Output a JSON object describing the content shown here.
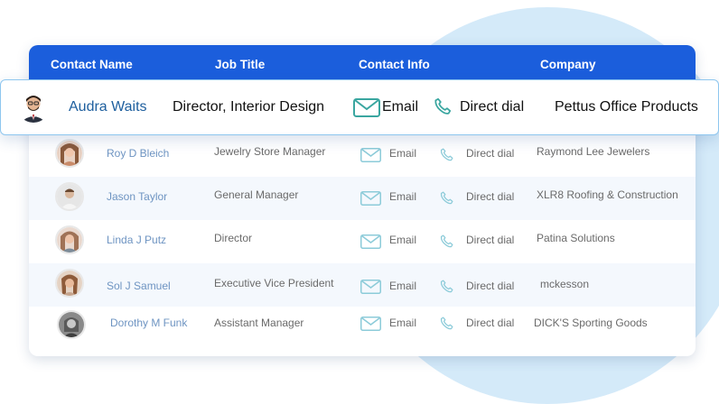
{
  "header": {
    "contact_name": "Contact Name",
    "job_title": "Job Title",
    "contact_info": "Contact Info",
    "company": "Company"
  },
  "featured": {
    "name": "Audra Waits",
    "title": "Director, Interior Design",
    "email": "Email",
    "phone": "Direct dial",
    "company": "Pettus Office Products"
  },
  "rows": [
    {
      "name": "Roy D Bleich",
      "title": "Jewelry Store Manager",
      "email": "Email",
      "phone": "Direct dial",
      "company": "Raymond Lee Jewelers"
    },
    {
      "name": "Jason Taylor",
      "title": "General Manager",
      "email": "Email",
      "phone": "Direct dial",
      "company": "XLR8 Roofing & Construction"
    },
    {
      "name": "Linda J Putz",
      "title": "Director",
      "email": "Email",
      "phone": "Direct dial",
      "company": "Patina Solutions"
    },
    {
      "name": "Sol J Samuel",
      "title": "Executive Vice President",
      "email": "Email",
      "phone": "Direct dial",
      "company": "mckesson"
    },
    {
      "name": "Dorothy M Funk",
      "title": "Assistant Manager",
      "email": "Email",
      "phone": "Direct dial",
      "company": "DICK'S Sporting Goods"
    }
  ],
  "colors": {
    "header_bg": "#1b5edc",
    "accent_teal": "#3aa6a0",
    "featured_name": "#1e5f9e",
    "row_name": "#6e94c2",
    "bg_circle": "#d4eaf9"
  },
  "icons": {
    "email": "envelope-icon",
    "phone": "phone-icon",
    "avatar": "avatar"
  }
}
